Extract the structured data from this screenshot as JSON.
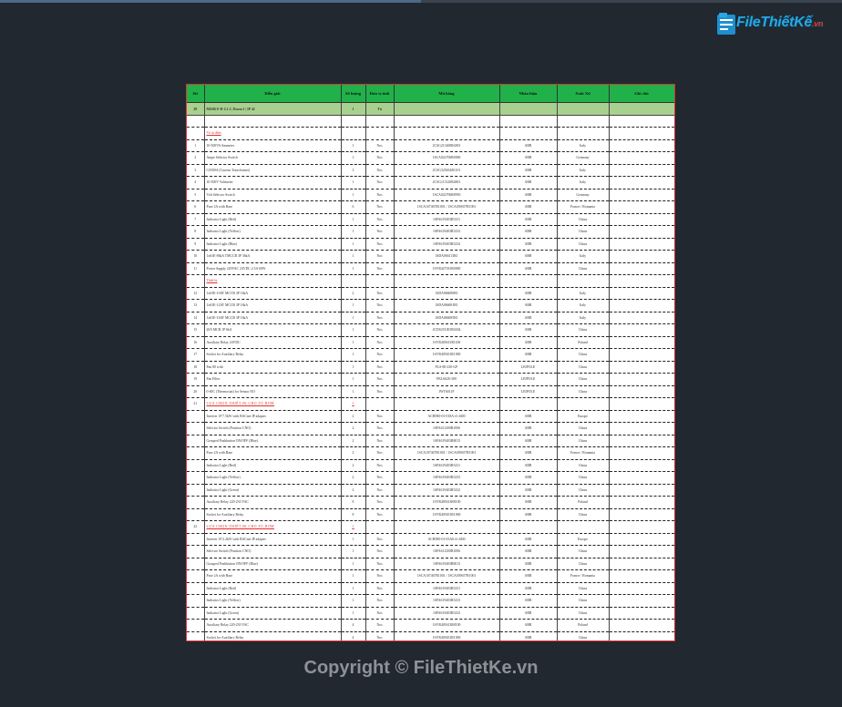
{
  "brand": {
    "logo_text": "FileThiếtKế",
    "logo_suffix": ".vn"
  },
  "copyright": "Copyright © FileThietKe.vn",
  "table": {
    "headers": [
      "Stt",
      "Diễn giải",
      "Số lượng",
      "Đơn vị tính",
      "Mã hàng",
      "Nhãn hiệu",
      "Xuất Xứ",
      "Ghi chú"
    ],
    "rows": [
      {
        "type": "sec",
        "no": "28",
        "desc": "MSSB-E-B-2.1.1 | Room 1 | IP 42",
        "qty": "1",
        "unit": "Tủ",
        "code": "",
        "brand": "",
        "origin": "",
        "note": ""
      },
      {
        "type": "blank"
      },
      {
        "type": "grp",
        "no": "",
        "desc": "Vỏ tủ điện",
        "qty": "",
        "unit": "",
        "code": "",
        "brand": "",
        "origin": "",
        "note": ""
      },
      {
        "type": "row",
        "no": "1",
        "desc": "10-500VA Ammeter",
        "qty": "1",
        "unit": "Nos",
        "code": "2CSG213469R4001",
        "brand": "ABB",
        "origin": "Italy",
        "note": ""
      },
      {
        "type": "row",
        "no": "2",
        "desc": "Ampe Selector Switch",
        "qty": "1",
        "unit": "Nos",
        "code": "1SCA022706R0000",
        "brand": "ABB",
        "origin": "Germany",
        "note": ""
      },
      {
        "type": "row",
        "no": "3",
        "desc": "CS500A (Current Transformer)",
        "qty": "3",
        "unit": "Nos",
        "code": "2CSG325654R1101",
        "brand": "ABB",
        "origin": "Italy",
        "note": ""
      },
      {
        "type": "row",
        "no": "4",
        "desc": "10-500V Voltmeter",
        "qty": "1",
        "unit": "Nos",
        "code": "2CSG113120R4001",
        "brand": "ABB",
        "origin": "Italy",
        "note": ""
      },
      {
        "type": "row",
        "no": "5",
        "desc": "Volt Selector Switch",
        "qty": "1",
        "unit": "Nos",
        "code": "1SCA022706R8950",
        "brand": "ABB",
        "origin": "Germany",
        "note": ""
      },
      {
        "type": "row",
        "no": "6",
        "desc": "Fuse 2A with Base",
        "qty": "6",
        "unit": "Nos",
        "code": "1SCA107467R1001 / 1SCA039657R1001",
        "brand": "ABB",
        "origin": "France / Romania",
        "note": ""
      },
      {
        "type": "row",
        "no": "7",
        "desc": "Indicator Light (Red)",
        "qty": "1",
        "unit": "Nos",
        "code": "1SFA619403R5231",
        "brand": "ABB",
        "origin": "China",
        "note": ""
      },
      {
        "type": "row",
        "no": "8",
        "desc": "Indicator Light (Yellow)",
        "qty": "1",
        "unit": "Nos",
        "code": "1SFA619403R5233",
        "brand": "ABB",
        "origin": "China",
        "note": ""
      },
      {
        "type": "row",
        "no": "9",
        "desc": "Indicator Light (Blue)",
        "qty": "1",
        "unit": "Nos",
        "code": "1SFA619403R5234",
        "brand": "ABB",
        "origin": "China",
        "note": ""
      },
      {
        "type": "row",
        "no": "10",
        "desc": "1x63E-86kA TMCCB 3P 36kA",
        "qty": "1",
        "unit": "Nos",
        "code": "1SDA066113R1",
        "brand": "ABB",
        "origin": "Italy",
        "note": ""
      },
      {
        "type": "row",
        "no": "11",
        "desc": "Power Supply 220VAC 24VDC 2.5A 60W",
        "qty": "1",
        "unit": "Nos",
        "code": "1SVR427031R0000",
        "brand": "ABB",
        "origin": "China",
        "note": ""
      },
      {
        "type": "grp",
        "no": "",
        "desc": "Thiết bị",
        "qty": "",
        "unit": "",
        "code": "",
        "brand": "",
        "origin": "",
        "note": ""
      },
      {
        "type": "row",
        "no": "12",
        "desc": "1x63E-10AT MCCB 3P 16kA",
        "qty": "2",
        "unit": "Nos",
        "code": "1SDA066690R1",
        "brand": "ABB",
        "origin": "Italy",
        "note": ""
      },
      {
        "type": "row",
        "no": "13",
        "desc": "1x63E-12AT MCCB 3P 16kA",
        "qty": "1",
        "unit": "Nos",
        "code": "1SDA066691R1",
        "brand": "ABB",
        "origin": "Italy",
        "note": ""
      },
      {
        "type": "row",
        "no": "14",
        "desc": "1x63E-16AT MCCB 3P 16kA",
        "qty": "1",
        "unit": "Nos",
        "code": "1SDA066695R1",
        "brand": "ABB",
        "origin": "Italy",
        "note": ""
      },
      {
        "type": "row",
        "no": "15",
        "desc": "20A MCB 1P 6kA",
        "qty": "1",
        "unit": "Nos",
        "code": "2CDS251001R0204",
        "brand": "ABB",
        "origin": "China",
        "note": ""
      },
      {
        "type": "row",
        "no": "16",
        "desc": "Auxiliary Relay 24VDC",
        "qty": "1",
        "unit": "Nos",
        "code": "1SVR405613R1100",
        "brand": "ABB",
        "origin": "Poland",
        "note": ""
      },
      {
        "type": "row",
        "no": "17",
        "desc": "Socket for Auxiliary Relay",
        "qty": "1",
        "unit": "Nos",
        "code": "1SVR405651R1000",
        "brand": "ABB",
        "origin": "China",
        "note": ""
      },
      {
        "type": "row",
        "no": "18",
        "desc": "Fan 80 with",
        "qty": "1",
        "unit": "Nos",
        "code": "FLS-80-230-GP",
        "brand": "LEIPOLE",
        "origin": "China",
        "note": ""
      },
      {
        "type": "row",
        "no": "19",
        "desc": "Fan Filter",
        "qty": "1",
        "unit": "Nos",
        "code": "FKL6626-300",
        "brand": "LEIPOLE",
        "origin": "China",
        "note": ""
      },
      {
        "type": "row",
        "no": "20",
        "desc": "0-60C (Thermostat) for Sensor NO",
        "qty": "1",
        "unit": "Nos",
        "code": "JWT6011F",
        "brand": "LEIPOLE",
        "origin": "China",
        "note": ""
      },
      {
        "type": "grpred",
        "no": "21",
        "desc": "LỰA CHỌN THIẾT BỊ CHO TỦ BƠM",
        "qty": "1",
        "unit": "",
        "code": "",
        "brand": "",
        "origin": "",
        "note": ""
      },
      {
        "type": "row",
        "no": "",
        "desc": "Inverter 1P 7.5kW with BACnet IP adapter",
        "qty": "2",
        "unit": "Nos",
        "code": "ACH580-01-018A-4+J400",
        "brand": "ABB",
        "origin": "Europe",
        "note": ""
      },
      {
        "type": "row",
        "no": "",
        "desc": "Selector Switch (Position CNO)",
        "qty": "2",
        "unit": "Nos",
        "code": "1SFA611200R1006",
        "brand": "ABB",
        "origin": "China",
        "note": ""
      },
      {
        "type": "row",
        "no": "",
        "desc": "Grouped Pushbutton ON/OFF (Blue)",
        "qty": "2",
        "unit": "Nos",
        "code": "1SFA619403R8013",
        "brand": "ABB",
        "origin": "China",
        "note": ""
      },
      {
        "type": "row",
        "no": "",
        "desc": "Fuse 2A with Base",
        "qty": "2",
        "unit": "Nos",
        "code": "1SCA107467R1001 / 1SCA039657R1001",
        "brand": "ABB",
        "origin": "France / Romania",
        "note": ""
      },
      {
        "type": "row",
        "no": "",
        "desc": "Indicator Light (Red)",
        "qty": "2",
        "unit": "Nos",
        "code": "1SFA619403R5231",
        "brand": "ABB",
        "origin": "China",
        "note": ""
      },
      {
        "type": "row",
        "no": "",
        "desc": "Indicator Light (Yellow)",
        "qty": "2",
        "unit": "Nos",
        "code": "1SFA619403R5233",
        "brand": "ABB",
        "origin": "China",
        "note": ""
      },
      {
        "type": "row",
        "no": "",
        "desc": "Indicator Light (Green)",
        "qty": "2",
        "unit": "Nos",
        "code": "1SFA619403R5232",
        "brand": "ABB",
        "origin": "China",
        "note": ""
      },
      {
        "type": "row",
        "no": "",
        "desc": "Auxiliary Relay 220-230 VAC",
        "qty": "8",
        "unit": "Nos",
        "code": "1SVR405613R8100",
        "brand": "ABB",
        "origin": "Poland",
        "note": ""
      },
      {
        "type": "row",
        "no": "",
        "desc": "Socket for Auxiliary Relay",
        "qty": "8",
        "unit": "Nos",
        "code": "1SVR405651R1000",
        "brand": "ABB",
        "origin": "China",
        "note": ""
      },
      {
        "type": "grpred",
        "no": "22",
        "desc": "LỰA CHỌN THIẾT BỊ CHO TỦ BƠM",
        "qty": "1",
        "unit": "",
        "code": "",
        "brand": "",
        "origin": "",
        "note": ""
      },
      {
        "type": "row",
        "no": "",
        "desc": "Inverter 1P 2.2kW with BACnet IP adapter",
        "qty": "1",
        "unit": "Nos",
        "code": "ACH580-01-05A6-4+J400",
        "brand": "ABB",
        "origin": "Europe",
        "note": ""
      },
      {
        "type": "row",
        "no": "",
        "desc": "Selector Switch (Position CNO)",
        "qty": "1",
        "unit": "Nos",
        "code": "1SFA611200R1006",
        "brand": "ABB",
        "origin": "China",
        "note": ""
      },
      {
        "type": "row",
        "no": "",
        "desc": "Grouped Pushbutton ON/OFF (Blue)",
        "qty": "1",
        "unit": "Nos",
        "code": "1SFA619403R8013",
        "brand": "ABB",
        "origin": "China",
        "note": ""
      },
      {
        "type": "row",
        "no": "",
        "desc": "Fuse 2A with Base",
        "qty": "1",
        "unit": "Nos",
        "code": "1SCA107467R1001 / 1SCA039657R1001",
        "brand": "ABB",
        "origin": "France / Romania",
        "note": ""
      },
      {
        "type": "row",
        "no": "",
        "desc": "Indicator Light (Red)",
        "qty": "1",
        "unit": "Nos",
        "code": "1SFA619403R5231",
        "brand": "ABB",
        "origin": "China",
        "note": ""
      },
      {
        "type": "row",
        "no": "",
        "desc": "Indicator Light (Yellow)",
        "qty": "1",
        "unit": "Nos",
        "code": "1SFA619403R5233",
        "brand": "ABB",
        "origin": "China",
        "note": ""
      },
      {
        "type": "row",
        "no": "",
        "desc": "Indicator Light (Green)",
        "qty": "1",
        "unit": "Nos",
        "code": "1SFA619403R5232",
        "brand": "ABB",
        "origin": "China",
        "note": ""
      },
      {
        "type": "row",
        "no": "",
        "desc": "Auxiliary Relay 220-230 VAC",
        "qty": "4",
        "unit": "Nos",
        "code": "1SVR405613R8100",
        "brand": "ABB",
        "origin": "Poland",
        "note": ""
      },
      {
        "type": "row",
        "no": "",
        "desc": "Socket for Auxiliary Relay",
        "qty": "4",
        "unit": "Nos",
        "code": "1SVR405651R1000",
        "brand": "ABB",
        "origin": "China",
        "note": ""
      }
    ]
  },
  "colors": {
    "header_bg": "#21b14a",
    "section_bg": "#a9d18e",
    "page_bg": "#212830",
    "border": "#dd3333"
  }
}
